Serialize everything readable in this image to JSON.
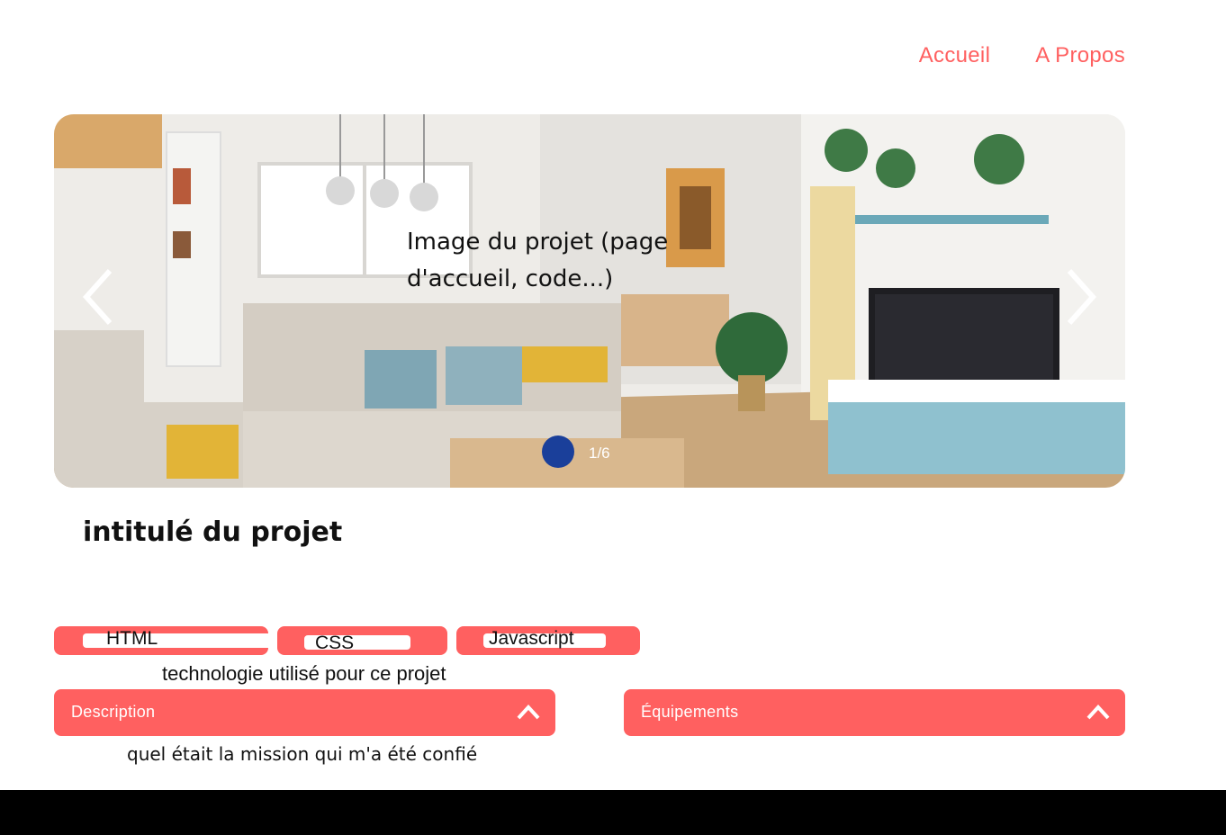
{
  "nav": {
    "items": [
      {
        "label": "Accueil"
      },
      {
        "label": "A Propos"
      }
    ]
  },
  "carousel": {
    "caption": "Image du projet (page\nd'accueil, code...)",
    "counter": "1/6"
  },
  "project": {
    "title": "intitulé du projet"
  },
  "tags": {
    "items": [
      {
        "label": "HTML"
      },
      {
        "label": "CSS"
      },
      {
        "label": "Javascript"
      }
    ],
    "note": "technologie utilisé pour ce  projet"
  },
  "collapses": {
    "description": {
      "title": "Description",
      "body": "quel était la mission qui m'a été confié"
    },
    "equipements": {
      "title": "Équipements"
    }
  },
  "colors": {
    "accent": "#ff6060",
    "footer": "#000000"
  }
}
